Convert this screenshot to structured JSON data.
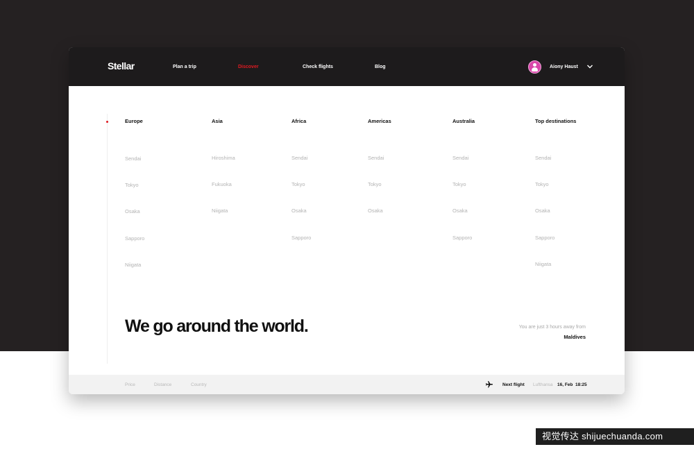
{
  "header": {
    "logo": "Stellar",
    "nav": [
      "Plan a trip",
      "Discover",
      "Check flights",
      "Blog"
    ],
    "active_nav": "Discover",
    "user_name": "Aiony Haust"
  },
  "regions": [
    {
      "name": "Europe",
      "cities": [
        "Sendai",
        "Tokyo",
        "Osaka",
        "Sapporo",
        "Niigata"
      ]
    },
    {
      "name": "Asia",
      "cities": [
        "Hiroshima",
        "Fukuoka",
        "Niigata"
      ]
    },
    {
      "name": "Africa",
      "cities": [
        "Sendai",
        "Tokyo",
        "Osaka",
        "Sapporo"
      ]
    },
    {
      "name": "Americas",
      "cities": [
        "Sendai",
        "Tokyo",
        "Osaka"
      ]
    },
    {
      "name": "Australia",
      "cities": [
        "Sendai",
        "Tokyo",
        "Osaka",
        "Sapporo"
      ]
    },
    {
      "name": "Top destinations",
      "cities": [
        "Sendai",
        "Tokyo",
        "Osaka",
        "Sapporo",
        "Niigata"
      ]
    }
  ],
  "hero": {
    "headline": "We go around the world.",
    "away_note": "You are just 3 hours away from",
    "destination": "Maldives"
  },
  "footer": {
    "filters": [
      "Price",
      "Distance",
      "Country"
    ],
    "next_flight_label": "Next flight",
    "airline": "Lufthansa",
    "date": "16, Feb",
    "time": "18:25"
  },
  "watermark": "视觉传达 shijuechuanda.com",
  "colors": {
    "accent": "#e01b22",
    "dark": "#1d1b1c",
    "backdrop": "#252122"
  },
  "icons": {
    "user": "avatar",
    "dropdown": "chevron-down-icon",
    "flight": "airplane-icon"
  }
}
